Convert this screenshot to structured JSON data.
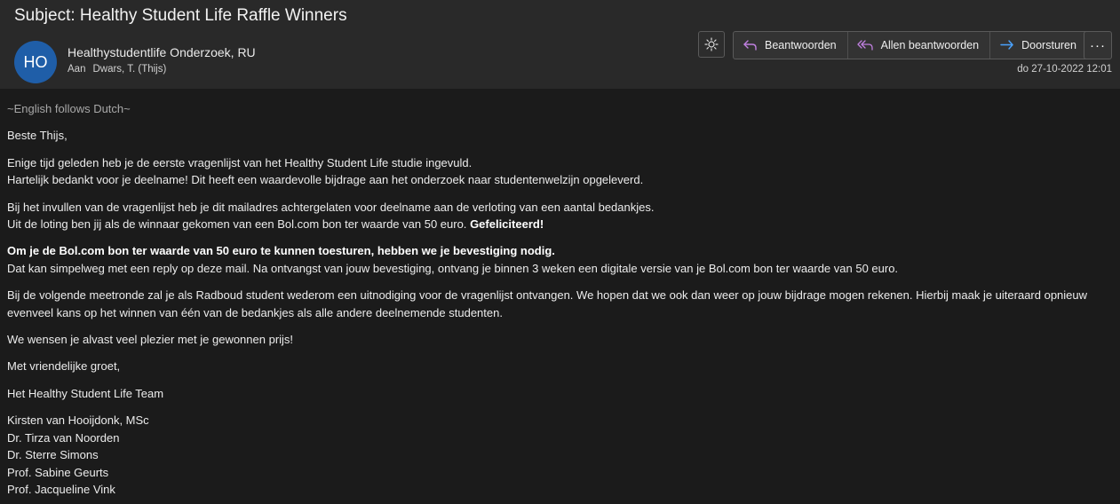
{
  "email": {
    "subject": "Subject: Healthy Student Life Raffle Winners",
    "avatar_initials": "HO",
    "sender": "Healthystudentlife Onderzoek, RU",
    "to_label": "Aan",
    "to_value": "Dwars, T. (Thijs)",
    "date": "do 27-10-2022 12:01"
  },
  "toolbar": {
    "theme_icon": "sun-icon",
    "reply_label": "Beantwoorden",
    "reply_all_label": "Allen beantwoorden",
    "forward_label": "Doorsturen",
    "more_label": "···"
  },
  "body": {
    "intro": "~English follows Dutch~",
    "greeting": "Beste Thijs,",
    "p1_line1": "Enige tijd geleden heb je de eerste vragenlijst van het Healthy Student Life studie ingevuld.",
    "p1_line2": "Hartelijk bedankt voor je deelname! Dit heeft een waardevolle bijdrage aan het onderzoek naar studentenwelzijn opgeleverd.",
    "p2_line1": "Bij het invullen van de vragenlijst heb je dit mailadres achtergelaten voor deelname aan de verloting van een aantal bedankjes.",
    "p2_line2": "Uit de loting ben jij als de winnaar gekomen van een Bol.com bon ter waarde van 50 euro.",
    "p2_bold": "Gefeliciteerd!",
    "p3_bold": "Om je de Bol.com bon ter waarde van 50 euro te kunnen toesturen, hebben we je bevestiging nodig.",
    "p3_line2": "Dat kan simpelweg met een reply op deze mail. Na ontvangst van jouw bevestiging, ontvang je binnen 3 weken een digitale versie van je Bol.com bon ter waarde van 50 euro.",
    "p4": "Bij de volgende meetronde zal je als Radboud student wederom een uitnodiging voor de vragenlijst ontvangen. We hopen dat we ook dan weer op jouw bijdrage mogen rekenen. Hierbij maak je uiteraard opnieuw evenveel kans op het winnen van één van de bedankjes als alle andere deelnemende studenten.",
    "p5": "We wensen je alvast veel plezier met je gewonnen prijs!",
    "closing": "Met vriendelijke groet,",
    "team": "Het Healthy Student Life Team",
    "signatures": [
      "Kirsten van Hooijdonk, MSc",
      "Dr. Tirza van Noorden",
      "Dr. Sterre Simons",
      "Prof. Sabine Geurts",
      "Prof. Jacqueline Vink"
    ]
  },
  "colors": {
    "avatar": "#1f5ea8",
    "reply_icon": "#c080e0",
    "forward_icon": "#4aa3ff"
  }
}
